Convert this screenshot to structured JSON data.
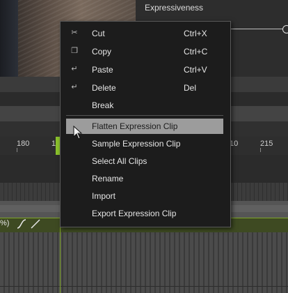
{
  "panel": {
    "expressiveness_label": "Expressiveness"
  },
  "ruler": {
    "ticks": [
      "180",
      "1",
      "10",
      "215"
    ]
  },
  "track": {
    "percent_label": "%)"
  },
  "context_menu": {
    "items": [
      {
        "label": "Cut",
        "shortcut": "Ctrl+X",
        "icon": "cut-icon"
      },
      {
        "label": "Copy",
        "shortcut": "Ctrl+C",
        "icon": "copy-icon"
      },
      {
        "label": "Paste",
        "shortcut": "Ctrl+V",
        "icon": "paste-icon"
      },
      {
        "label": "Delete",
        "shortcut": "Del",
        "icon": "delete-icon"
      },
      {
        "label": "Break",
        "shortcut": ""
      },
      {
        "label": "Flatten Expression Clip",
        "shortcut": "",
        "highlighted": true
      },
      {
        "label": "Sample Expression Clip",
        "shortcut": ""
      },
      {
        "label": "Select All Clips",
        "shortcut": ""
      },
      {
        "label": "Rename",
        "shortcut": ""
      },
      {
        "label": "Import",
        "shortcut": ""
      },
      {
        "label": "Export Expression Clip",
        "shortcut": ""
      }
    ]
  },
  "colors": {
    "accent_green": "#8bc22c",
    "menu_bg": "#1c1c1c",
    "highlight": "#9c9c9c"
  }
}
